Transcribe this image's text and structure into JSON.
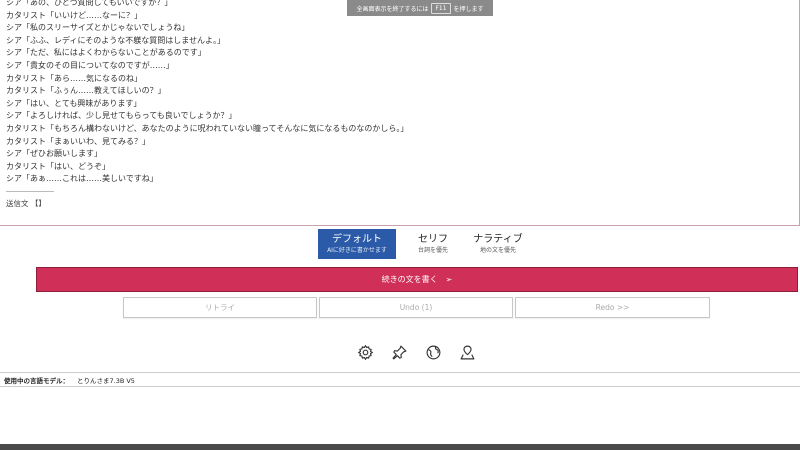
{
  "fullscreen_banner": {
    "before": "全画面表示を終了するには",
    "key": "F11",
    "after": "を押します"
  },
  "story": {
    "lines": [
      "シア「あの、ひとつ質問してもいいですか？」",
      "カタリスト「いいけど……なーに？」",
      "シア「私のスリーサイズとかじゃないでしょうね」",
      "シア「ふふ、レディにそのような不躾な質問はしませんよ。」",
      "シア「ただ、私にはよくわからないことがあるのです」",
      "シア「貴女のその目についてなのですが……」",
      "カタリスト「あら……気になるのね」",
      "カタリスト「ふぅん……教えてほしいの？」",
      "シア「はい、とても興味があります」",
      "シア「よろしければ、少し見せてもらっても良いでしょうか？」",
      "カタリスト「もちろん構わないけど、あなたのように呪われていない瞳ってそんなに気になるものなのかしら。」",
      "カタリスト「まぁいいわ、見てみる？」",
      "シア「ぜひお願いします」",
      "カタリスト「はい、どうぞ」",
      "シア「あぁ……これは……美しいですね」"
    ],
    "send_label": "送信文 【】"
  },
  "modes": [
    {
      "title": "デフォルト",
      "sub": "AIに好きに書かせます"
    },
    {
      "title": "セリフ",
      "sub": "台詞を優先"
    },
    {
      "title": "ナラティブ",
      "sub": "地の文を優先"
    }
  ],
  "actions": {
    "continue_label": "続きの文を書く",
    "continue_arrow": "➢",
    "retry_label": "リトライ",
    "undo_label": "Undo (1)",
    "redo_label": "Redo >>"
  },
  "icons": [
    "gear-icon",
    "pin-icon",
    "globe-icon",
    "map-pin-icon"
  ],
  "model": {
    "label": "使用中の言語モデル：",
    "value": "とりんさま7.3B V5"
  },
  "colors": {
    "accent_mode": "#2a5aa8",
    "continue_button": "#d03058"
  }
}
